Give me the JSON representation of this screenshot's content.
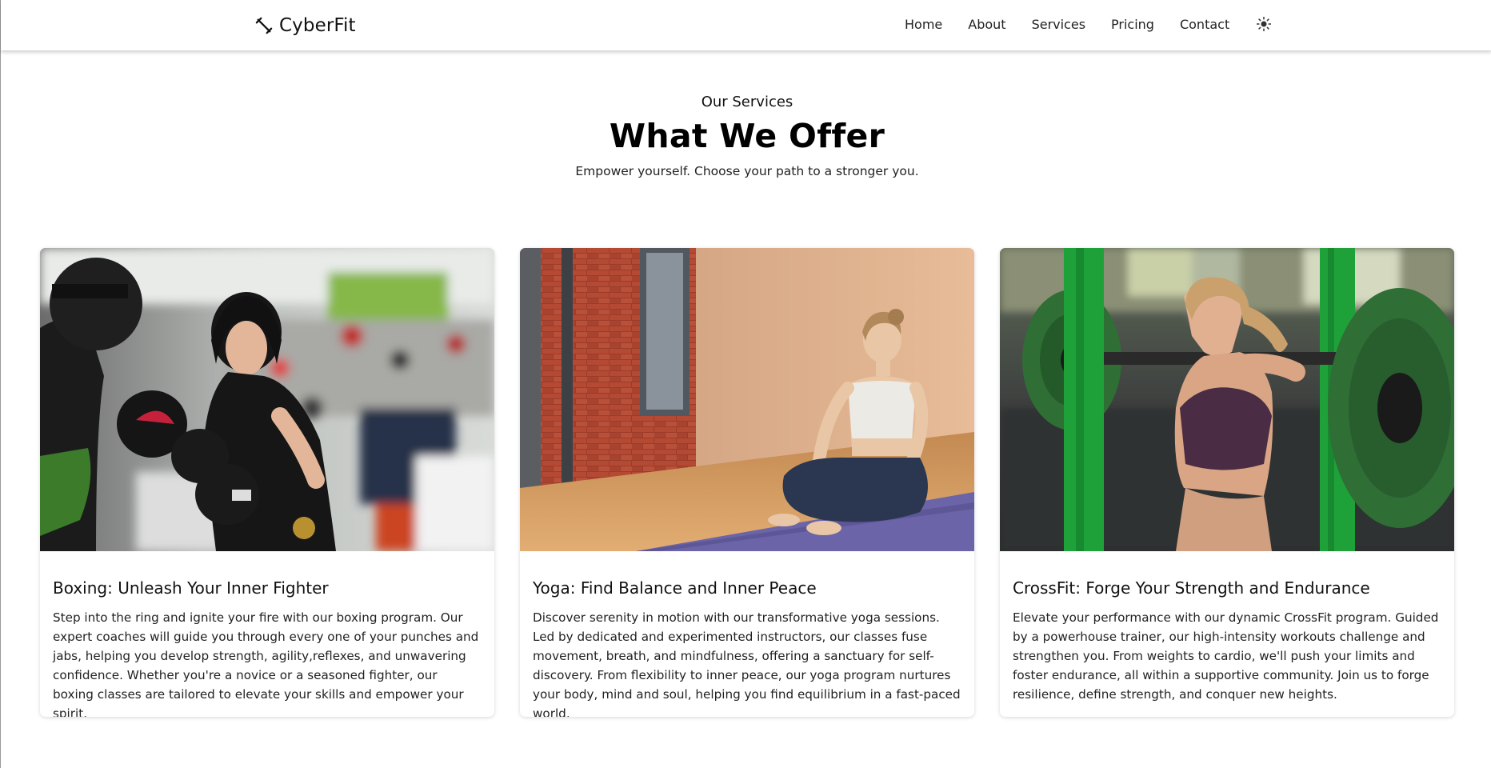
{
  "navbar": {
    "brand": "CyberFit",
    "links": [
      "Home",
      "About",
      "Services",
      "Pricing",
      "Contact"
    ]
  },
  "services": {
    "eyebrow": "Our Services",
    "headline": "What We Offer",
    "subtitle": "Empower yourself. Choose your path to a stronger you.",
    "cards": [
      {
        "title": "Boxing: Unleash Your Inner Fighter",
        "text": "Step into the ring and ignite your fire with our boxing program. Our expert coaches will guide you through every one of your punches and jabs, helping you develop strength, agility,reflexes, and unwavering confidence. Whether you're a novice or a seasoned fighter, our boxing classes are tailored to elevate your skills and empower your spirit."
      },
      {
        "title": "Yoga: Find Balance and Inner Peace",
        "text": "Discover serenity in motion with our transformative yoga sessions. Led by dedicated and experimented instructors, our classes fuse movement, breath, and mindfulness, offering a sanctuary for self-discovery. From flexibility to inner peace, our yoga program nurtures your body, mind and soul, helping you find equilibrium in a fast-paced world."
      },
      {
        "title": "CrossFit: Forge Your Strength and Endurance",
        "text": "Elevate your performance with our dynamic CrossFit program. Guided by a powerhouse trainer, our high-intensity workouts challenge and strengthen you. From weights to cardio, we'll push your limits and foster endurance, all within a supportive community. Join us to forge resilience, define strength, and conquer new heights."
      }
    ]
  },
  "icons": {
    "brand": "dumbbell-icon",
    "theme": "sun-icon"
  }
}
